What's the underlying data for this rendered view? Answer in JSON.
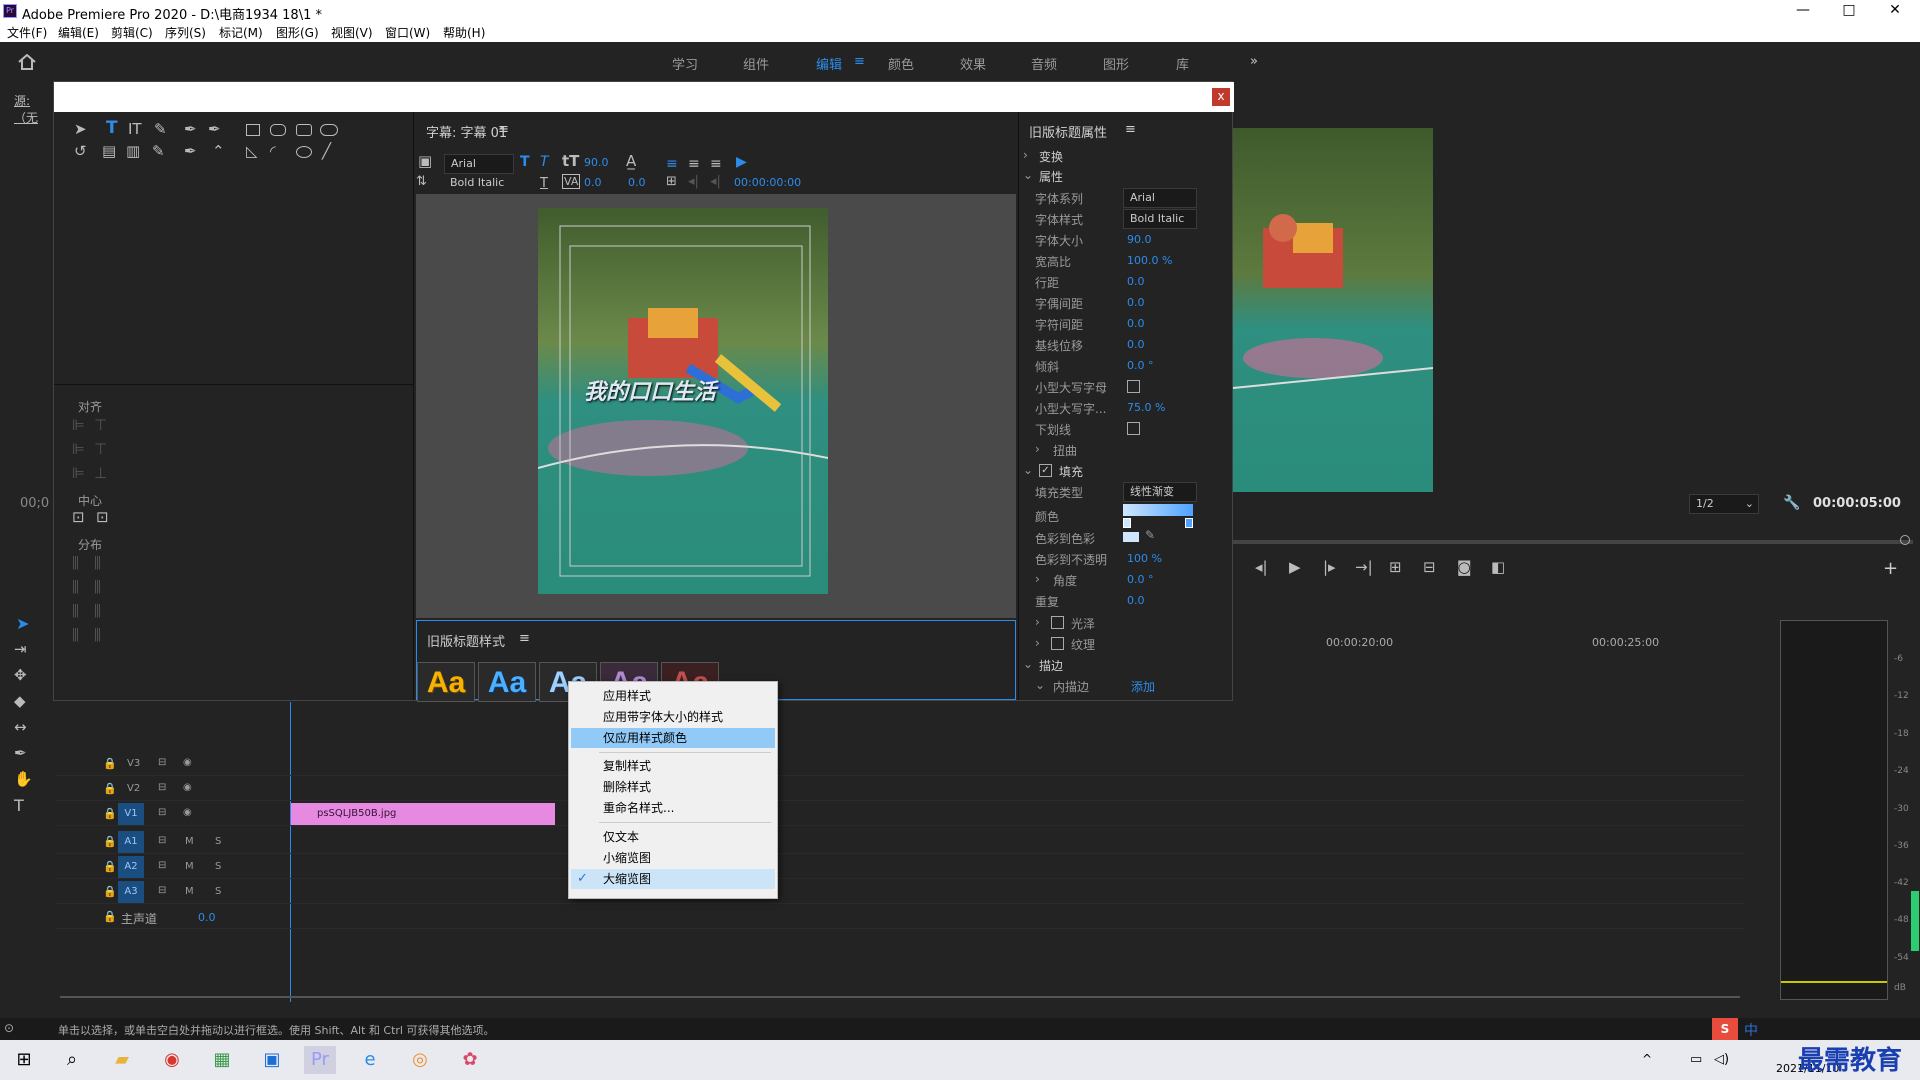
{
  "window": {
    "title": "Adobe Premiere Pro 2020 - D:\\电商1934 18\\1 *",
    "app_icon": "Pr",
    "min": "—",
    "max": "□",
    "close": "✕"
  },
  "menu": [
    "文件(F)",
    "编辑(E)",
    "剪辑(C)",
    "序列(S)",
    "标记(M)",
    "图形(G)",
    "视图(V)",
    "窗口(W)",
    "帮助(H)"
  ],
  "workspaces": [
    "学习",
    "组件",
    "编辑",
    "颜色",
    "效果",
    "音频",
    "图形",
    "库"
  ],
  "workspace_active_icon": "≡",
  "more_icon": "»",
  "source_tab": "源:（无",
  "timecode_left": "00;0",
  "dialog": {
    "close": "x",
    "subtitle_panel": "字幕: 字幕 01",
    "menu_icon": "≡",
    "font_family": "Arial",
    "font_style": "Bold Italic",
    "font_size": "90.0",
    "kerning": "0.0",
    "leading": "0.0",
    "timecode": "00:00:00:00",
    "canvas_text": "我的口口生活",
    "align_panel": {
      "align": "对齐",
      "center": "中心",
      "distribute": "分布"
    },
    "styles_panel": {
      "title": "旧版标题样式",
      "swatch": "Aa"
    },
    "props": {
      "title": "旧版标题属性",
      "transform": "变换",
      "attributes": "属性",
      "rows": [
        {
          "label": "字体系列",
          "value": "Arial"
        },
        {
          "label": "字体样式",
          "value": "Bold Italic"
        },
        {
          "label": "字体大小",
          "value": "90.0"
        },
        {
          "label": "宽高比",
          "value": "100.0 %"
        },
        {
          "label": "行距",
          "value": "0.0"
        },
        {
          "label": "字偶间距",
          "value": "0.0"
        },
        {
          "label": "字符间距",
          "value": "0.0"
        },
        {
          "label": "基线位移",
          "value": "0.0"
        },
        {
          "label": "倾斜",
          "value": "0.0 °"
        },
        {
          "label": "小型大写字母",
          "value": ""
        },
        {
          "label": "小型大写字...",
          "value": "75.0 %"
        },
        {
          "label": "下划线",
          "value": ""
        }
      ],
      "distort": "扭曲",
      "fill": "填充",
      "fill_type_label": "填充类型",
      "fill_type": "线性渐变",
      "color_label": "颜色",
      "color_to_color": "色彩到色彩",
      "color_to_opacity": "色彩到不透明",
      "opacity_value": "100 %",
      "angle_label": "角度",
      "angle_value": "0.0 °",
      "repeat_label": "重复",
      "repeat_value": "0.0",
      "sheen": "光泽",
      "texture": "纹理",
      "stroke": "描边",
      "inner_stroke": "内描边",
      "add": "添加"
    }
  },
  "context_menu": {
    "items": [
      "应用样式",
      "应用带字体大小的样式",
      "仅应用样式颜色",
      "复制样式",
      "删除样式",
      "重命名样式...",
      "仅文本",
      "小缩览图",
      "大缩览图"
    ],
    "checkmark": "✓"
  },
  "program": {
    "zoom": "1/2",
    "dropdown": "⌄",
    "timecode": "00:00:05:00",
    "add": "+"
  },
  "timeline": {
    "ruler": [
      "00:00:20:00",
      "00:00:25:00"
    ],
    "tracks": [
      "V3",
      "V2",
      "V1",
      "A1",
      "A2",
      "A3"
    ],
    "master": "主声道",
    "master_val": "0.0",
    "clip": "psSQLJB50B.jpg",
    "m": "M",
    "s": "S"
  },
  "meter_labels": [
    "-6",
    "-12",
    "-18",
    "-24",
    "-30",
    "-36",
    "-42",
    "-48",
    "-54",
    "dB"
  ],
  "status": "单击以选择，或单击空白处并拖动以进行框选。使用 Shift、Alt 和 Ctrl 可获得其他选项。",
  "ime": "中",
  "taskbar": {
    "date": "2021/11/10",
    "watermark": "最需教育"
  },
  "colors": {
    "accent": "#2d8ceb",
    "clip": "#e58ae0",
    "track_box": "#1a4d80",
    "menu_highlight": "#91c9f7"
  }
}
